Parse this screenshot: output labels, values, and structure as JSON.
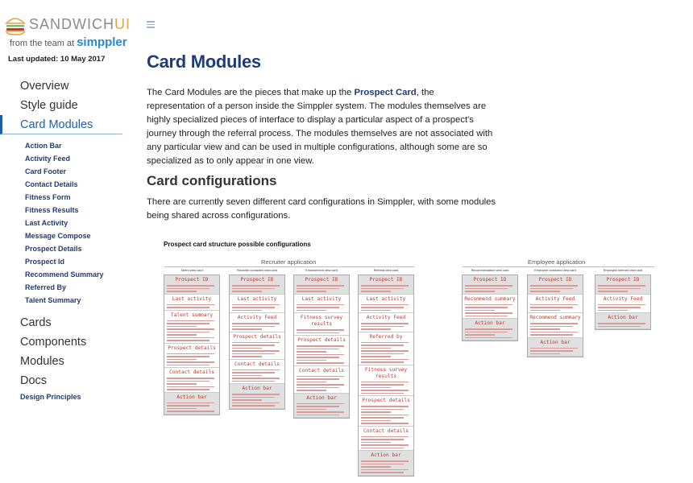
{
  "logo": {
    "word_main": "SANDWICH",
    "word_accent": "UI",
    "sub_prefix": "from the team at",
    "brand": "simppler"
  },
  "updated": "Last updated: 10 May 2017",
  "nav": {
    "overview": "Overview",
    "style_guide": "Style guide",
    "card_modules": "Card Modules",
    "sub_items": [
      "Action Bar",
      "Activity Feed",
      "Card Footer",
      "Contact Details",
      "Fitness Form",
      "Fitness Results",
      "Last Activity",
      "Message Compose",
      "Prospect Details",
      "Prospect Id",
      "Recommend Summary",
      "Referred By",
      "Talent Summary"
    ],
    "cards": "Cards",
    "components": "Components",
    "modules": "Modules",
    "docs": "Docs",
    "design_principles": "Design Principles"
  },
  "main": {
    "title": "Card Modules",
    "intro_pre": "The Card Modules are the pieces that make up the ",
    "intro_link": "Prospect Card",
    "intro_post": ", the representation of a person inside the Simppler system. The modules themselves are highly specialized pieces of interface to display a particular aspect of a prospect's journey through the referral process. The modules themselves are not associated with any particular view and can be used in multiple configurations, although some are so specialized as to only appear in one view.",
    "h2": "Card configurations",
    "para2": "There are currently seven different card configurations in Simppler, with some modules being shared across configurations."
  },
  "figure": {
    "title": "Prospect card structure possible configurations",
    "group_recruiter": "Recruiter application",
    "group_employee": "Employee application",
    "cards": [
      {
        "label": "Talent view card",
        "sections": [
          {
            "t": "Prospect ID",
            "lines": 3
          },
          {
            "t": "Last activity",
            "lines": 2
          },
          {
            "t": "Talent summary",
            "lines": 8
          },
          {
            "t": "Prospect details",
            "lines": 5
          },
          {
            "t": "Contact details",
            "lines": 5
          },
          {
            "t": "Action bar",
            "lines": 4
          }
        ]
      },
      {
        "label": "Recruiter contacted view card",
        "sections": [
          {
            "t": "Prospect ID",
            "lines": 3
          },
          {
            "t": "Last activity",
            "lines": 3
          },
          {
            "t": "Activity Feed",
            "lines": 3
          },
          {
            "t": "Prospect details",
            "lines": 6
          },
          {
            "t": "Contact details",
            "lines": 5
          },
          {
            "t": "Action bar",
            "lines": 5
          }
        ]
      },
      {
        "label": "Endorsement view card",
        "sections": [
          {
            "t": "Prospect ID",
            "lines": 3
          },
          {
            "t": "Last activity",
            "lines": 3
          },
          {
            "t": "Fitness survey results",
            "lines": 2
          },
          {
            "t": "Prospect details",
            "lines": 7
          },
          {
            "t": "Contact details",
            "lines": 6
          },
          {
            "t": "Action bar",
            "lines": 5
          }
        ]
      },
      {
        "label": "Referral view card",
        "sections": [
          {
            "t": "Prospect ID",
            "lines": 3
          },
          {
            "t": "Last activity",
            "lines": 3
          },
          {
            "t": "Activity Feed",
            "lines": 3
          },
          {
            "t": "Referred by",
            "lines": 8
          },
          {
            "t": "Fitness survey results",
            "lines": 5
          },
          {
            "t": "Prospect details",
            "lines": 7
          },
          {
            "t": "Contact details",
            "lines": 5
          },
          {
            "t": "Action bar",
            "lines": 5
          }
        ]
      },
      {
        "label": "Recommendation view card",
        "sections": [
          {
            "t": "Prospect ID",
            "lines": 3
          },
          {
            "t": "Recommend summary",
            "lines": 5
          },
          {
            "t": "Action bar",
            "lines": 4
          }
        ]
      },
      {
        "label": "Employee contacted view card",
        "sections": [
          {
            "t": "Prospect ID",
            "lines": 3
          },
          {
            "t": "Activity Feed",
            "lines": 3
          },
          {
            "t": "Recommend summary",
            "lines": 5
          },
          {
            "t": "Action bar",
            "lines": 3
          }
        ]
      },
      {
        "label": "Employee referred view card",
        "sections": [
          {
            "t": "Prospect ID",
            "lines": 3
          },
          {
            "t": "Activity Feed",
            "lines": 3
          },
          {
            "t": "Action bar",
            "lines": 2
          }
        ]
      }
    ]
  },
  "colors": {
    "accent": "#1e3c7a",
    "active_nav": "#1f5fa8",
    "module_title": "#c0392b"
  }
}
